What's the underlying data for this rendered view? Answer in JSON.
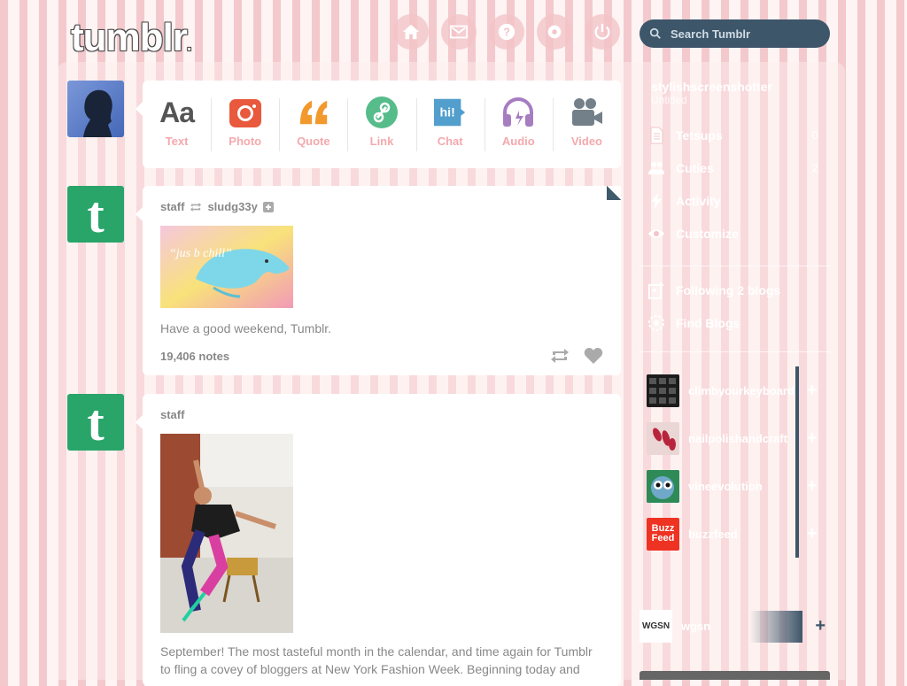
{
  "header": {
    "logo": "tumblr",
    "logo_dot": ".",
    "nav": [
      "home-icon",
      "inbox-icon",
      "help-icon",
      "settings-icon",
      "logout-icon"
    ],
    "search_placeholder": "Search Tumblr"
  },
  "compose": {
    "types": [
      {
        "label": "Text",
        "icon": "text-icon",
        "color": "#555555"
      },
      {
        "label": "Photo",
        "icon": "camera-icon",
        "color": "#e9593d"
      },
      {
        "label": "Quote",
        "icon": "quote-icon",
        "color": "#f2992e"
      },
      {
        "label": "Link",
        "icon": "link-icon",
        "color": "#56bc8a"
      },
      {
        "label": "Chat",
        "icon": "chat-icon",
        "color": "#529ecc"
      },
      {
        "label": "Audio",
        "icon": "headphones-icon",
        "color": "#a77dc2"
      },
      {
        "label": "Video",
        "icon": "video-icon",
        "color": "#748089"
      }
    ],
    "chat_glyph": "hi!",
    "text_glyph": "Aa"
  },
  "posts": [
    {
      "author": "staff",
      "reblogged_from": "sludg33y",
      "image_caption": "“jus b chill”",
      "text": "Have a good weekend, Tumblr.",
      "notes": "19,406 notes"
    },
    {
      "author": "staff",
      "text": "September! The most tasteful month in the calendar, and time again for Tumblr to fling a covey of bloggers at New York Fashion Week. Beginning today and"
    }
  ],
  "avatar_glyph": "t",
  "sidebar": {
    "blog_name": "stylishscreenshotter",
    "blog_subtitle": "Untitled",
    "items": [
      {
        "label": "Tetsups",
        "count": "0",
        "icon": "posts-icon"
      },
      {
        "label": "Cuties",
        "count": "2",
        "icon": "followers-icon"
      },
      {
        "label": "Activity",
        "count": "",
        "icon": "activity-icon"
      },
      {
        "label": "Customize",
        "count": "",
        "icon": "eye-icon"
      }
    ],
    "following": [
      {
        "label": "Following 2 blogs",
        "icon": "following-icon"
      },
      {
        "label": "Find Blogs",
        "icon": "find-blogs-icon"
      }
    ],
    "recommended": [
      {
        "name": "climbyourkeyboard",
        "avatar": "#222222"
      },
      {
        "name": "nailpolishandcraft",
        "avatar": "#e8cfcf"
      },
      {
        "name": "vineevolution",
        "avatar": "#3a6b4a"
      },
      {
        "name": "buzzfeed",
        "avatar": "#ee3322",
        "avatar_text": "Buzz Feed"
      }
    ],
    "spotlight": {
      "name": "wgsn",
      "avatar_text": "WGSN"
    }
  }
}
